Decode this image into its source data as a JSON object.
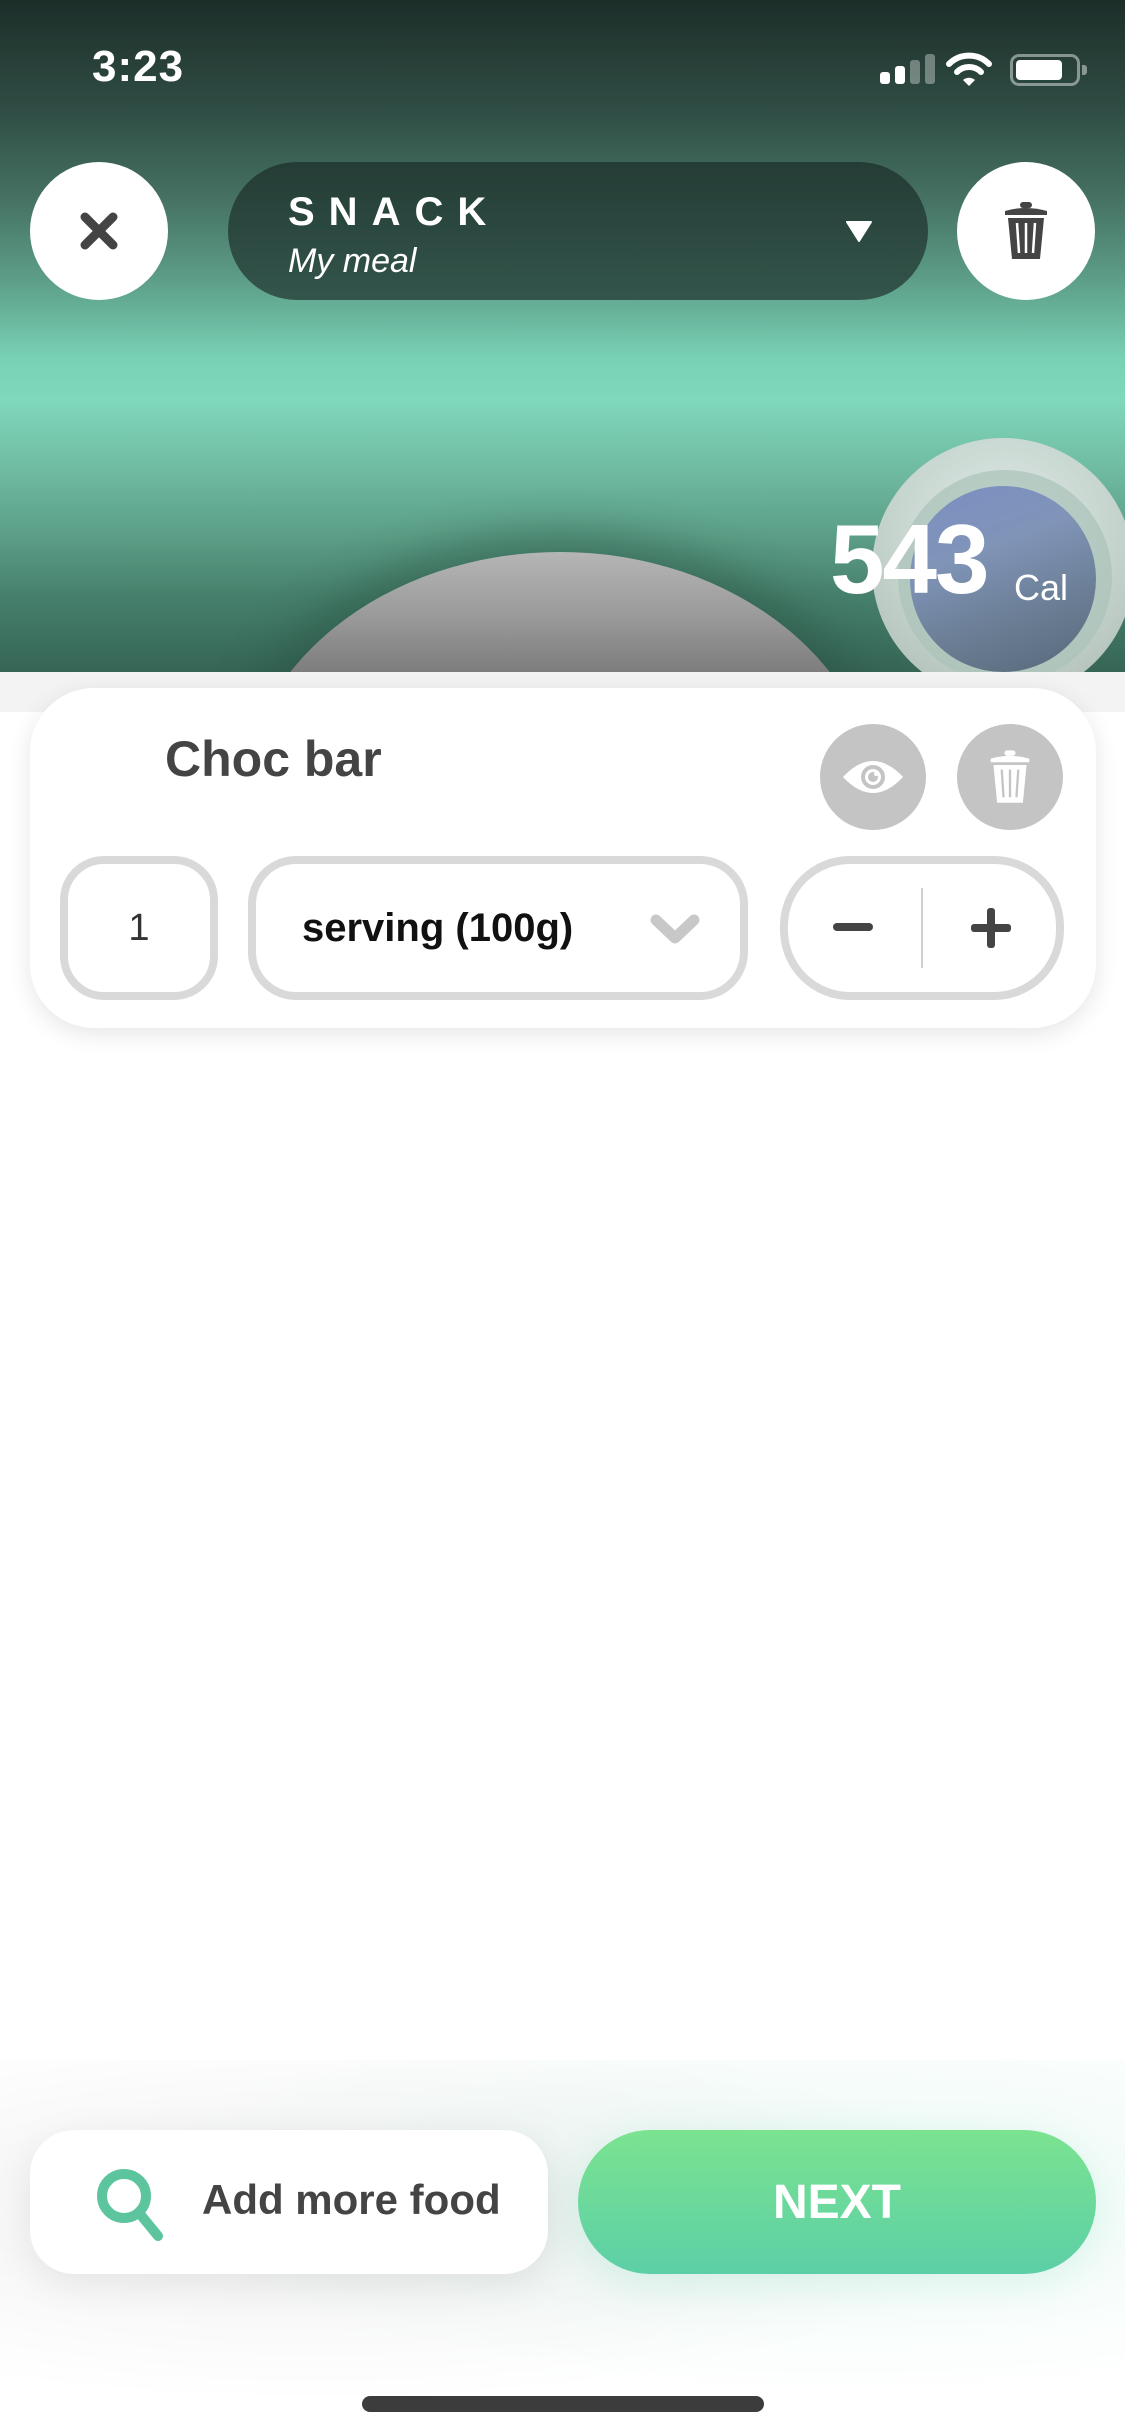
{
  "status_bar": {
    "time": "3:23",
    "icons": [
      "signal-icon",
      "wifi-icon",
      "battery-icon"
    ]
  },
  "header": {
    "close_icon": "close-icon",
    "meal_type": "SNACK",
    "meal_name": "My meal",
    "dropdown_icon": "caret-down-icon",
    "delete_icon": "trash-icon"
  },
  "calories": {
    "value": "543",
    "unit": "Cal"
  },
  "food_items": [
    {
      "name": "Choc bar",
      "quantity": "1",
      "unit": "serving (100g)",
      "actions": [
        "eye-icon",
        "trash-icon"
      ],
      "stepper": {
        "minus": "−",
        "plus": "+"
      }
    }
  ],
  "footer": {
    "add_food_label": "Add more food",
    "add_food_icon": "search-icon",
    "next_label": "NEXT"
  },
  "colors": {
    "accent_green": "#5ccfa6",
    "header_dark": "#243c35",
    "icon_dark": "#444444",
    "muted_gray": "#c4c4c4"
  }
}
